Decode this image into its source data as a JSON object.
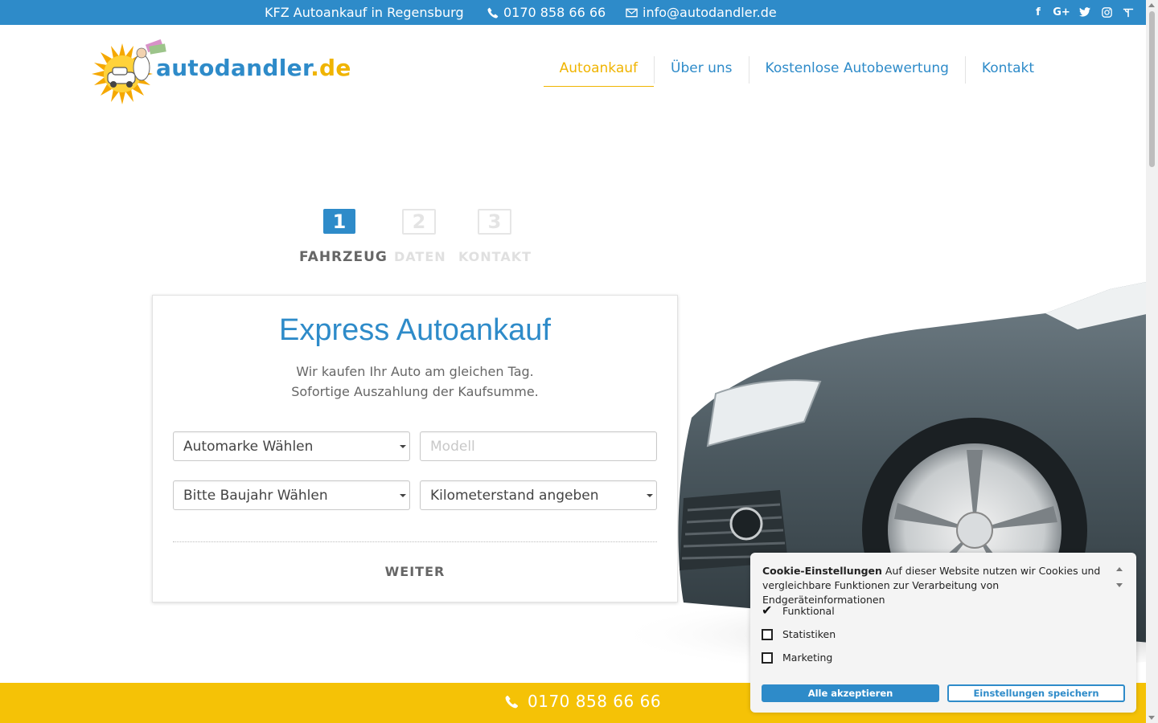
{
  "topbar": {
    "tagline": "KFZ Autoankauf in Regensburg",
    "phone": "0170 858 66 66",
    "email": "info@autodandler.de",
    "social": [
      "facebook-icon",
      "google-plus-icon",
      "twitter-icon",
      "instagram-icon",
      "tripadvisor-icon"
    ]
  },
  "header": {
    "logo_main": "autodandler",
    "logo_tld": ".de",
    "nav": [
      "Autoankauf",
      "Über uns",
      "Kostenlose Autobewertung",
      "Kontakt"
    ]
  },
  "steps": [
    {
      "num": "1",
      "label": "FAHRZEUG"
    },
    {
      "num": "2",
      "label": "DATEN"
    },
    {
      "num": "3",
      "label": "KONTAKT"
    }
  ],
  "form": {
    "title": "Express Autoankauf",
    "subtitle_line1": "Wir kaufen Ihr Auto am gleichen Tag.",
    "subtitle_line2": "Sofortige Auszahlung der Kaufsumme.",
    "brand_select": "Automarke Wählen",
    "model_placeholder": "Modell",
    "year_select": "Bitte Baujahr Wählen",
    "km_select": "Kilometerstand angeben",
    "next_label": "WEITER"
  },
  "bottombar": {
    "phone": "0170 858 66 66"
  },
  "cookie": {
    "title": "Cookie-Einstellungen",
    "text": "Auf dieser Website nutzen wir Cookies und vergleichbare Funktionen zur Verarbeitung von Endgeräteinformationen",
    "options": [
      {
        "label": "Funktional",
        "checked": true
      },
      {
        "label": "Statistiken",
        "checked": false
      },
      {
        "label": "Marketing",
        "checked": false
      }
    ],
    "accept_all": "Alle akzeptieren",
    "save": "Einstellungen speichern"
  },
  "colors": {
    "brand_blue": "#2e8bc9",
    "brand_yellow": "#f5c206",
    "nav_active": "#f0b400"
  }
}
